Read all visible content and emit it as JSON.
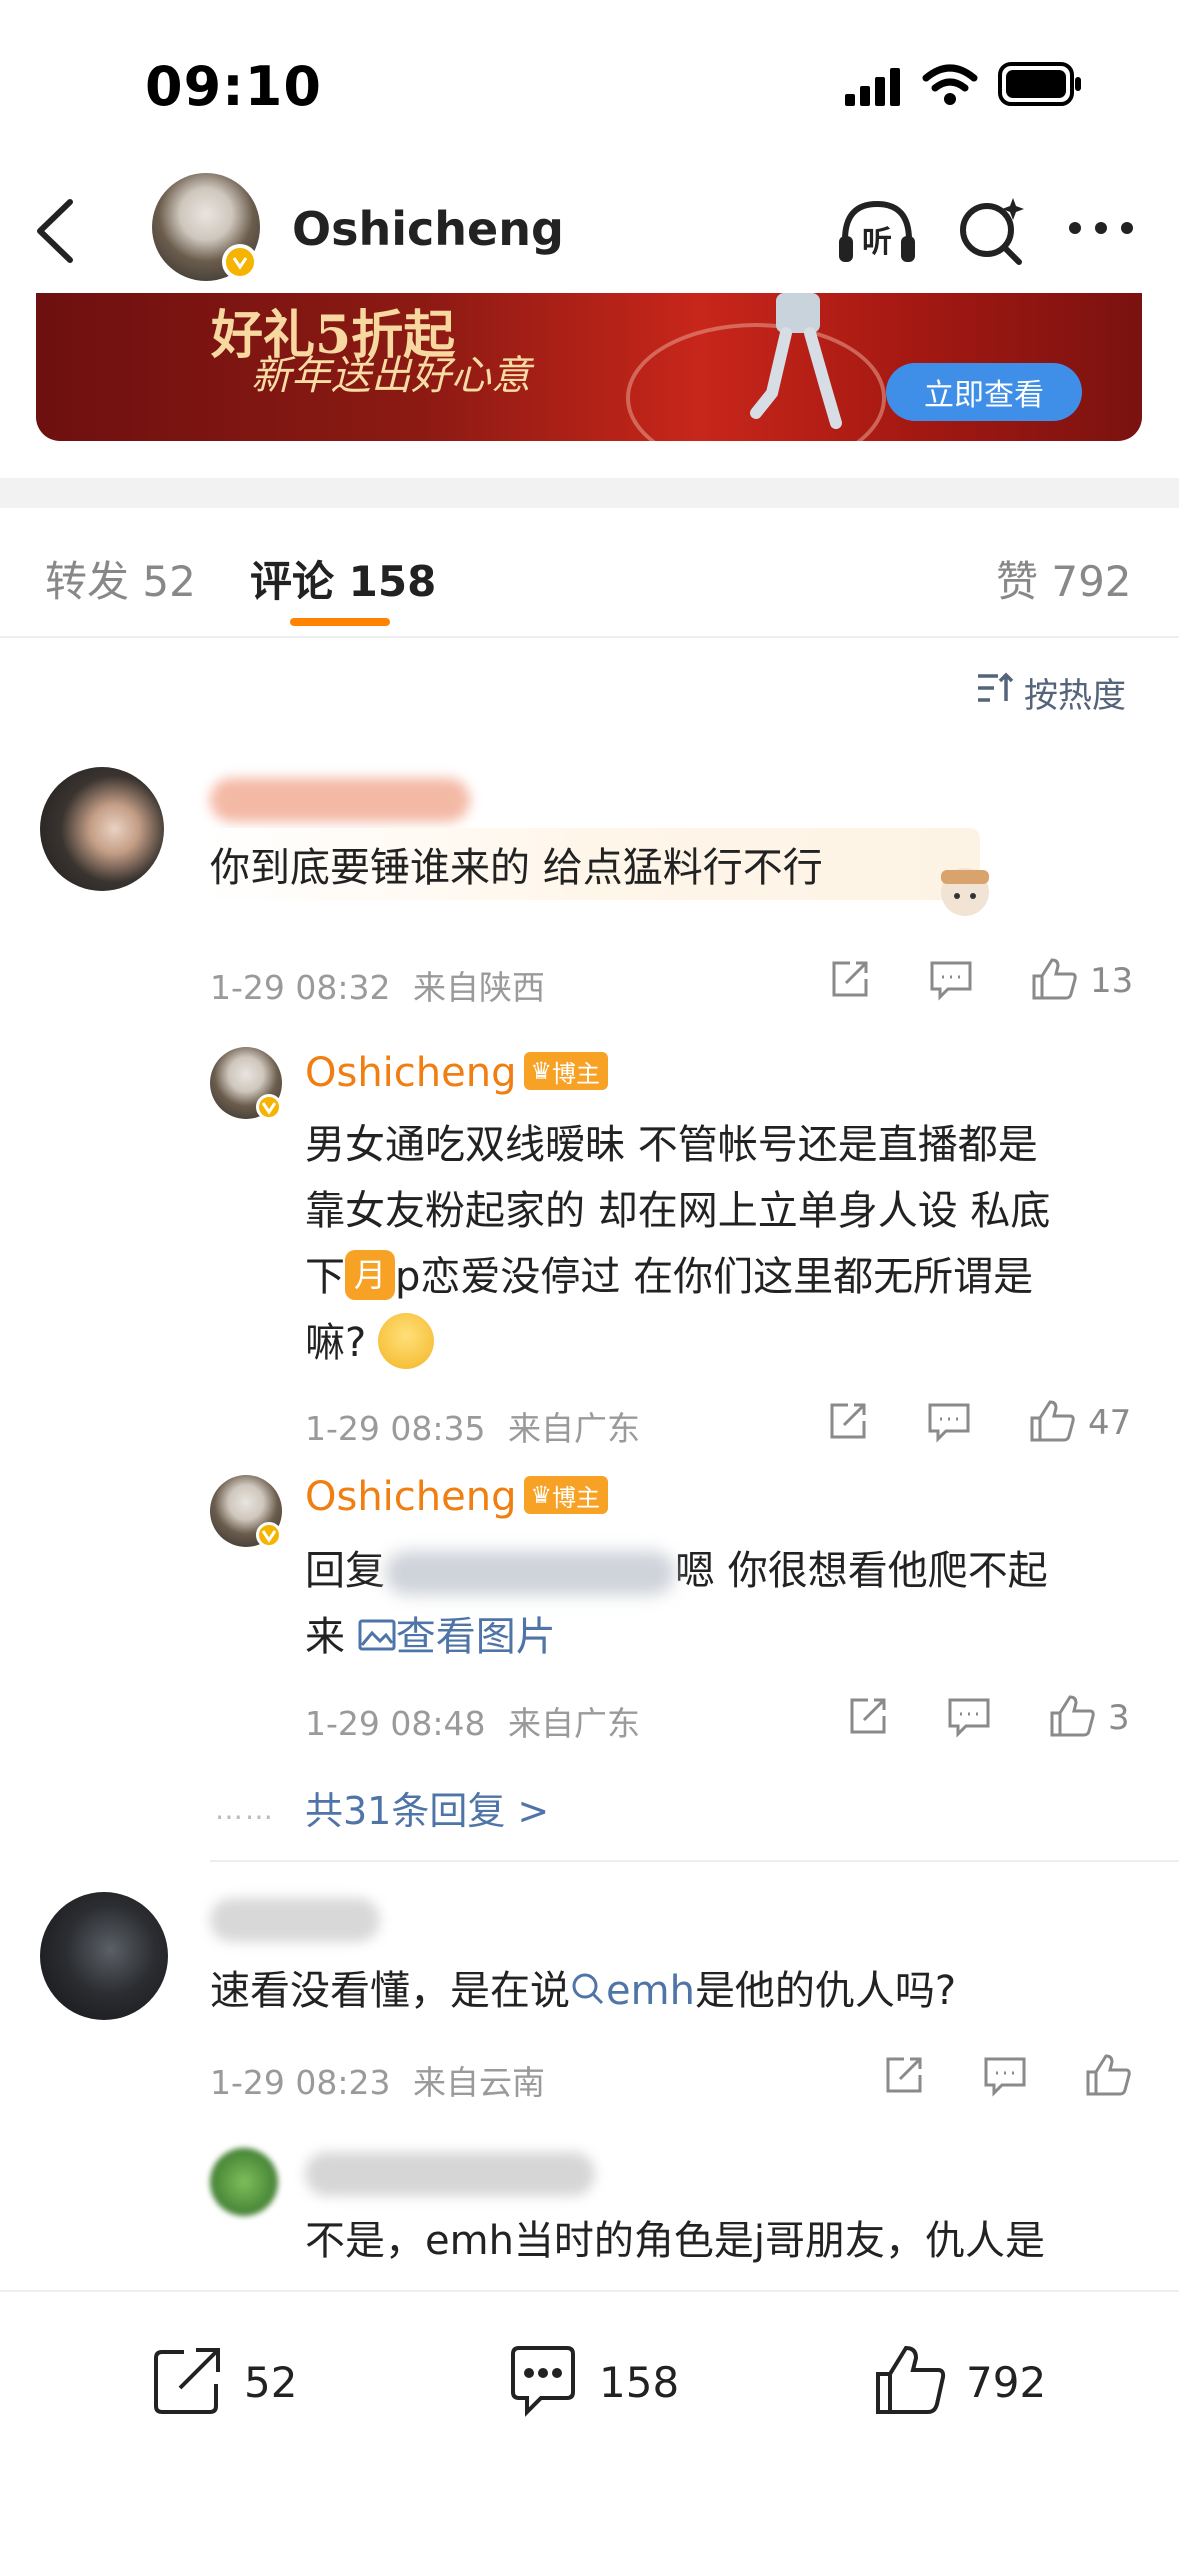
{
  "status_bar": {
    "time": "09:10"
  },
  "nav": {
    "title": "Oshicheng"
  },
  "banner": {
    "line1": "好礼5折起",
    "line2": "新年送出好心意",
    "button": "立即查看"
  },
  "tabs": [
    {
      "label": "转发 52"
    },
    {
      "label": "评论 158"
    },
    {
      "label": "赞 792"
    }
  ],
  "sort": {
    "label": "按热度"
  },
  "comments": [
    {
      "text": "你到底要锤谁来的 给点猛料行不行",
      "time": "1-29 08:32",
      "location": "来自陕西",
      "likes": "13",
      "replies": [
        {
          "name": "Oshicheng",
          "badge": "博主",
          "text_a": "男女通吃双线暧昧 不管帐号还是直播都是",
          "text_b": "靠女友粉起家的 却在网上立单身人设 私底",
          "text_c_pre": "下",
          "month": "月",
          "text_c_post": "p恋爱没停过 在你们这里都无所谓是",
          "text_d": "嘛?",
          "time": "1-29 08:35",
          "location": "来自广东",
          "likes": "47"
        },
        {
          "name": "Oshicheng",
          "badge": "博主",
          "text_pre": "回复",
          "text_post": "嗯 你很想看他爬不起",
          "text_line2": "来",
          "link": "查看图片",
          "time": "1-29 08:48",
          "location": "来自广东",
          "likes": "3"
        }
      ],
      "more_replies": "共31条回复 >"
    },
    {
      "text_pre": "速看没看懂，是在说",
      "mention": "emh",
      "text_post": "是他的仇人吗?",
      "time": "1-29 08:23",
      "location": "来自云南",
      "reply_preview": "不是，emh当时的角色是j哥朋友，仇人是"
    }
  ],
  "bottom_bar": {
    "repost": "52",
    "comment": "158",
    "like": "792"
  }
}
